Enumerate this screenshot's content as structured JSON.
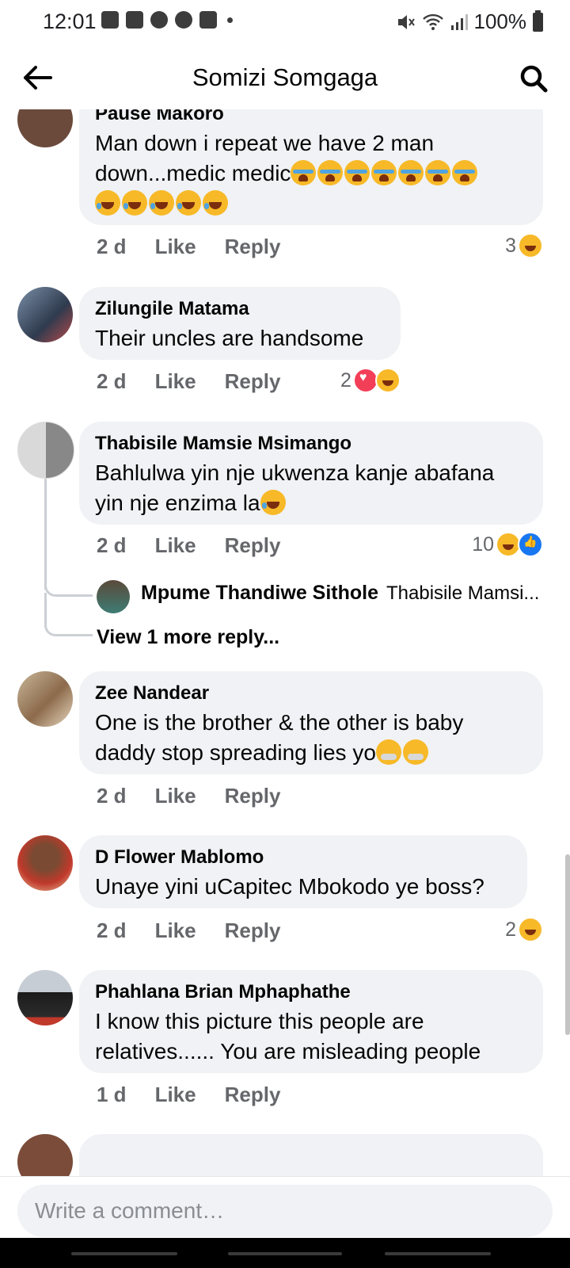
{
  "status_bar": {
    "time": "12:01",
    "battery": "100%",
    "dot": "•"
  },
  "header": {
    "title": "Somizi Somgaga"
  },
  "comments": [
    {
      "author": "Pause Makoro",
      "text": "Man down i repeat we have 2 man down...medic medic",
      "time": "2 d",
      "like_label": "Like",
      "reply_label": "Reply",
      "reaction_count": "3",
      "reaction_icons": [
        "haha"
      ]
    },
    {
      "author": "Zilungile Matama",
      "text": "Their uncles are handsome",
      "time": "2 d",
      "like_label": "Like",
      "reply_label": "Reply",
      "reaction_count": "2",
      "reaction_icons": [
        "love",
        "haha"
      ]
    },
    {
      "author": "Thabisile Mamsie Msimango",
      "text": "Bahlulwa yin nje ukwenza kanje abafana yin nje enzima la",
      "time": "2 d",
      "like_label": "Like",
      "reply_label": "Reply",
      "reaction_count": "10",
      "reaction_icons": [
        "haha",
        "like"
      ],
      "reply_preview": {
        "author": "Mpume Thandiwe Sithole",
        "snippet": "Thabisile Mamsi..."
      },
      "more_replies": "View 1 more reply..."
    },
    {
      "author": "Zee Nandear",
      "text": "One is the brother & the other is baby daddy stop spreading lies  yo",
      "time": "2 d",
      "like_label": "Like",
      "reply_label": "Reply"
    },
    {
      "author": "D Flower Mablomo",
      "text": "Unaye yini uCapitec Mbokodo ye boss?",
      "time": "2 d",
      "like_label": "Like",
      "reply_label": "Reply",
      "reaction_count": "2",
      "reaction_icons": [
        "haha"
      ]
    },
    {
      "author": "Phahlana Brian Mphaphathe",
      "text": "I know this picture this people are relatives...... You are misleading people",
      "time": "1 d",
      "like_label": "Like",
      "reply_label": "Reply"
    }
  ],
  "composer": {
    "placeholder": "Write a comment…"
  },
  "colors": {
    "bubble": "#f0f2f5",
    "meta": "#65676b",
    "haha": "#f7b928",
    "love": "#f33e58",
    "like": "#1877f2"
  }
}
